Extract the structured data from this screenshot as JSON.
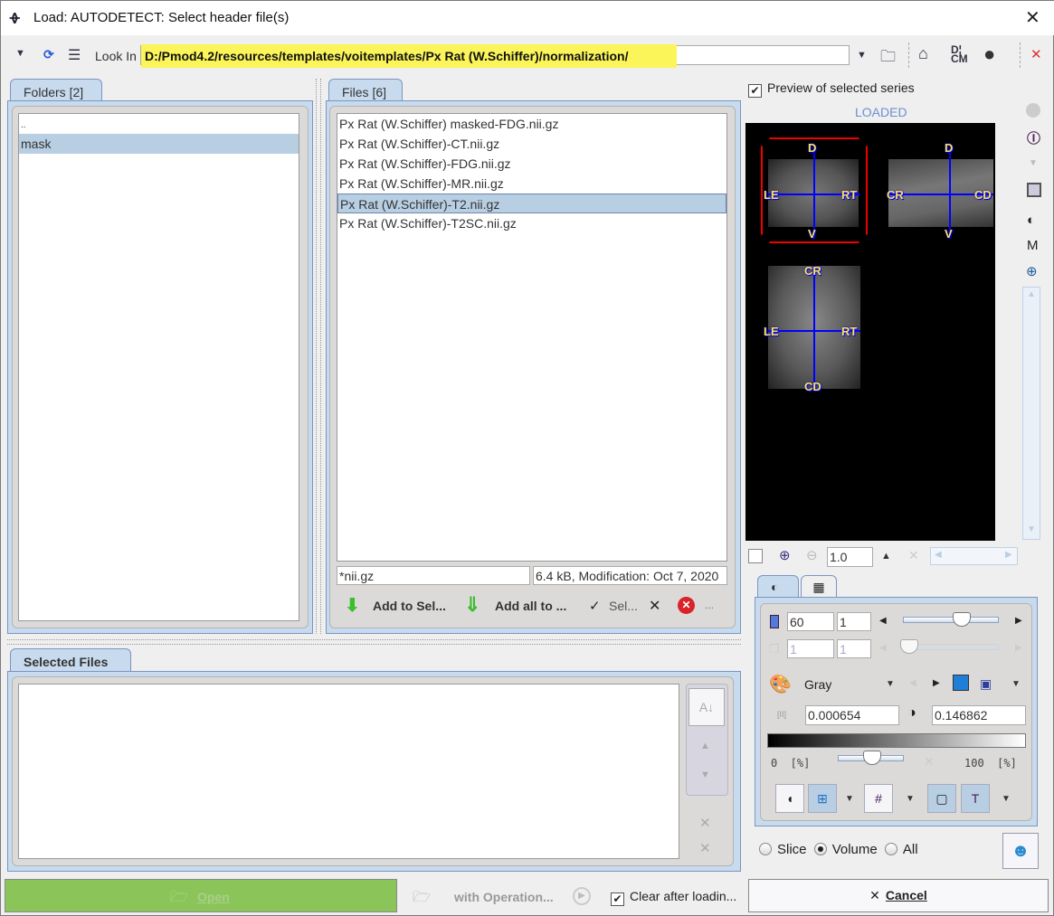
{
  "window": {
    "title": "Load: AUTODETECT: Select header file(s)",
    "app_icon": "pmod-logo-icon",
    "close_label": "✕"
  },
  "toolbar": {
    "look_in_label": "Look In",
    "path": "D:/Pmod4.2/resources/templates/voitemplates/Px Rat (W.Schiffer)/normalization/",
    "highlight_color": "#fbf55a"
  },
  "folders": {
    "tab_label": "Folders [2]",
    "items": [
      {
        "label": "..",
        "selected": false
      },
      {
        "label": "mask",
        "selected": true
      }
    ]
  },
  "files": {
    "tab_label": "Files [6]",
    "items": [
      {
        "label": "Px Rat (W.Schiffer) masked-FDG.nii.gz",
        "selected": false
      },
      {
        "label": "Px Rat (W.Schiffer)-CT.nii.gz",
        "selected": false
      },
      {
        "label": "Px Rat (W.Schiffer)-FDG.nii.gz",
        "selected": false
      },
      {
        "label": "Px Rat (W.Schiffer)-MR.nii.gz",
        "selected": false
      },
      {
        "label": "Px Rat (W.Schiffer)-T2.nii.gz",
        "selected": true
      },
      {
        "label": "Px Rat (W.Schiffer)-T2SC.nii.gz",
        "selected": false
      }
    ],
    "filter_value": "*nii.gz",
    "info": "6.4 kB,  Modification: Oct 7, 2020",
    "add_to_selected": "Add to Sel...",
    "add_all_to": "Add all to ...",
    "select_label": "Sel...",
    "more_label": "..."
  },
  "selected_files": {
    "tab_label": "Selected Files"
  },
  "bottom": {
    "open_label": "Open",
    "with_operation_label": "with Operation...",
    "clear_after_loading_label": "Clear after loadin...",
    "clear_after_loading_checked": true,
    "cancel_label": "Cancel",
    "open_color": "#8bc55a"
  },
  "preview": {
    "checkbox_label": "Preview of selected series",
    "checked": true,
    "status": "LOADED",
    "status_color": "#6a8fd0",
    "orientation_labels": {
      "coronal": {
        "top": "D",
        "bottom": "V",
        "left": "LE",
        "right": "RT"
      },
      "sagittal": {
        "top": "D",
        "bottom": "V",
        "left": "CR",
        "right": "CD"
      },
      "axial": {
        "top": "CR",
        "bottom": "CD",
        "left": "LE",
        "right": "RT"
      }
    },
    "zoom_value": "1.0"
  },
  "controls": {
    "slice_value": "60",
    "slice_step": "1",
    "slice_slider_fraction": 0.6,
    "frame_value": "1",
    "frame_step": "1",
    "colormap": "Gray",
    "min_value": "0.000654",
    "max_value": "0.146862",
    "min_pct_label": "0  [%]",
    "max_pct_label": "100  [%]",
    "range_slider_fraction": 0.5
  },
  "mode": {
    "options": [
      "Slice",
      "Volume",
      "All"
    ],
    "selected": "Volume"
  }
}
